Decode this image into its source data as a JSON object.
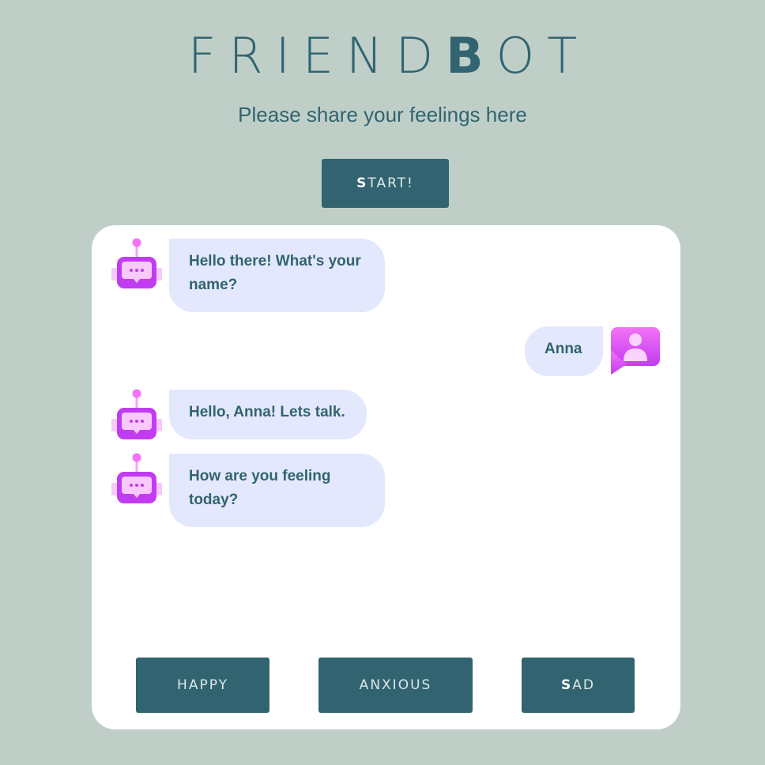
{
  "header": {
    "logo_text_a": "FRIEND",
    "logo_text_b": "B",
    "logo_text_c": "OT",
    "subtitle": "Please share your feelings here"
  },
  "start_button": {
    "first_char": "S",
    "rest": "TART!"
  },
  "chat": {
    "messages": [
      {
        "sender": "bot",
        "text": "Hello there! What's your name?"
      },
      {
        "sender": "user",
        "text": "Anna"
      },
      {
        "sender": "bot",
        "text": "Hello, Anna! Lets talk."
      },
      {
        "sender": "bot",
        "text": "How are you feeling today?"
      }
    ]
  },
  "moods": {
    "happy": {
      "first_char": "H",
      "rest": "APPY"
    },
    "anxious": {
      "first_char": "A",
      "rest": "NXIOUS"
    },
    "sad": {
      "first_char": "S",
      "rest": "AD"
    }
  },
  "colors": {
    "background": "#bfcfc8",
    "primary": "#316470",
    "bubble": "#e4e8fd",
    "avatar_accent": "#d946ef"
  },
  "icons": {
    "bot": "robot-chat-icon",
    "user": "user-avatar-icon"
  }
}
